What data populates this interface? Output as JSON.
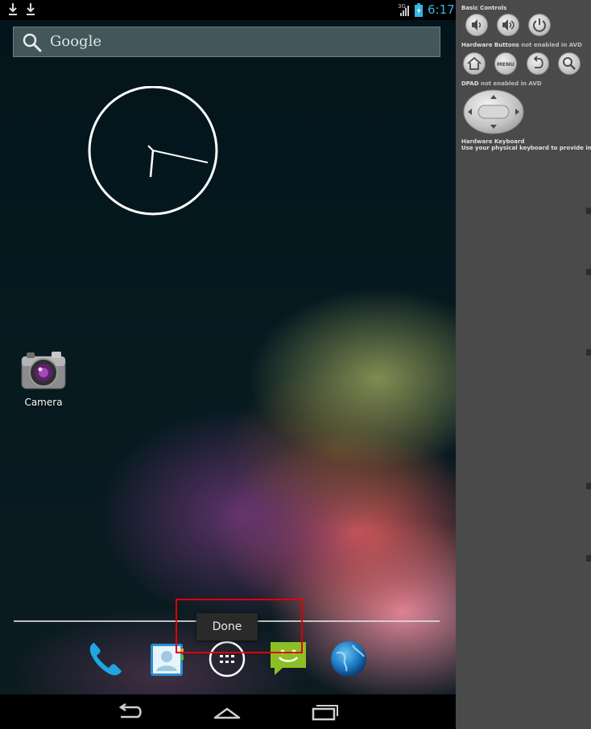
{
  "statusbar": {
    "time": "6:17",
    "network": "3G",
    "notifications": [
      "download-icon",
      "download-icon"
    ],
    "time_color": "#33b5e5"
  },
  "home": {
    "search": {
      "placeholder": "Google"
    },
    "camera": {
      "label": "Camera"
    },
    "dock": [
      "phone-icon",
      "contacts-icon",
      "app-drawer-icon",
      "messaging-icon",
      "browser-icon"
    ]
  },
  "tooltip": {
    "text": "Done"
  },
  "navbar": [
    "back-icon",
    "home-icon",
    "recent-apps-icon"
  ],
  "sidepanel": {
    "basic_controls_title": "Basic Controls",
    "hw_buttons_title": "Hardware Buttons",
    "hw_buttons_note": "not enabled in AVD",
    "menu_label": "MENU",
    "dpad_title": "DPAD",
    "dpad_note": "not enabled in AVD",
    "keyboard_title": "Hardware Keyboard",
    "keyboard_note": "Use your physical keyboard to provide input"
  },
  "colors": {
    "highlight": "#e00000",
    "panel": "#4a4a4a"
  }
}
